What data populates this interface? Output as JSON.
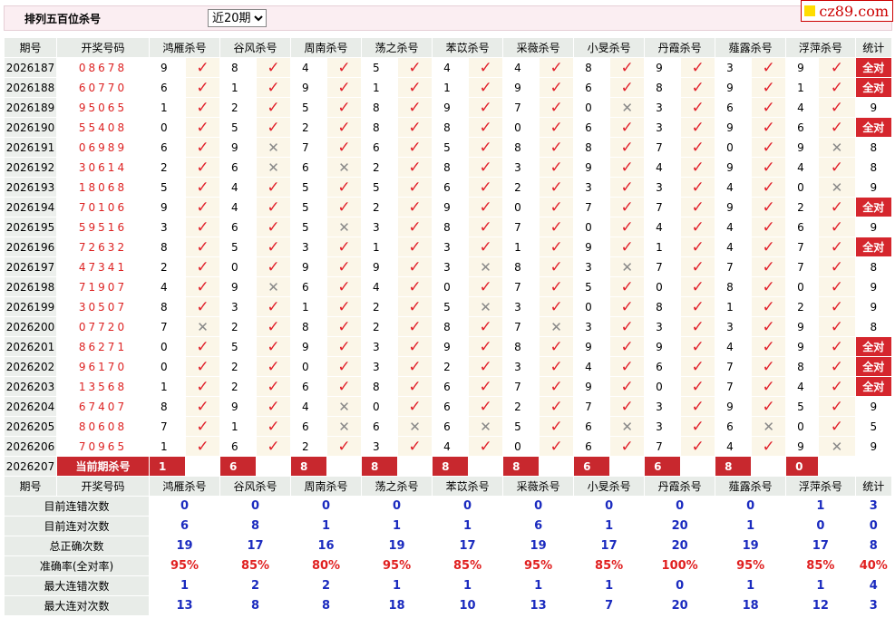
{
  "header": {
    "title": "排列五百位杀号",
    "period_select": "近20期",
    "logo": "cz89.com"
  },
  "columns": [
    "期号",
    "开奖号码",
    "鸿雁杀号",
    "谷风杀号",
    "周南杀号",
    "荡之杀号",
    "苯苡杀号",
    "采薇杀号",
    "小旻杀号",
    "丹霞杀号",
    "薤露杀号",
    "浮萍杀号",
    "统计"
  ],
  "rows": [
    {
      "period": "2026187",
      "code": "08678",
      "kills": [
        [
          9,
          1
        ],
        [
          8,
          1
        ],
        [
          4,
          1
        ],
        [
          5,
          1
        ],
        [
          4,
          1
        ],
        [
          4,
          1
        ],
        [
          8,
          1
        ],
        [
          9,
          1
        ],
        [
          3,
          1
        ],
        [
          9,
          1
        ]
      ],
      "stat": "全对"
    },
    {
      "period": "2026188",
      "code": "60770",
      "kills": [
        [
          6,
          1
        ],
        [
          1,
          1
        ],
        [
          9,
          1
        ],
        [
          1,
          1
        ],
        [
          1,
          1
        ],
        [
          9,
          1
        ],
        [
          6,
          1
        ],
        [
          8,
          1
        ],
        [
          9,
          1
        ],
        [
          1,
          1
        ]
      ],
      "stat": "全对"
    },
    {
      "period": "2026189",
      "code": "95065",
      "kills": [
        [
          1,
          1
        ],
        [
          2,
          1
        ],
        [
          5,
          1
        ],
        [
          8,
          1
        ],
        [
          9,
          1
        ],
        [
          7,
          1
        ],
        [
          0,
          0
        ],
        [
          3,
          1
        ],
        [
          6,
          1
        ],
        [
          4,
          1
        ]
      ],
      "stat": "9"
    },
    {
      "period": "2026190",
      "code": "55408",
      "kills": [
        [
          0,
          1
        ],
        [
          5,
          1
        ],
        [
          2,
          1
        ],
        [
          8,
          1
        ],
        [
          8,
          1
        ],
        [
          0,
          1
        ],
        [
          6,
          1
        ],
        [
          3,
          1
        ],
        [
          9,
          1
        ],
        [
          6,
          1
        ]
      ],
      "stat": "全对"
    },
    {
      "period": "2026191",
      "code": "06989",
      "kills": [
        [
          6,
          1
        ],
        [
          9,
          0
        ],
        [
          7,
          1
        ],
        [
          6,
          1
        ],
        [
          5,
          1
        ],
        [
          8,
          1
        ],
        [
          8,
          1
        ],
        [
          7,
          1
        ],
        [
          0,
          1
        ],
        [
          9,
          0
        ]
      ],
      "stat": "8"
    },
    {
      "period": "2026192",
      "code": "30614",
      "kills": [
        [
          2,
          1
        ],
        [
          6,
          0
        ],
        [
          6,
          0
        ],
        [
          2,
          1
        ],
        [
          8,
          1
        ],
        [
          3,
          1
        ],
        [
          9,
          1
        ],
        [
          4,
          1
        ],
        [
          9,
          1
        ],
        [
          4,
          1
        ]
      ],
      "stat": "8"
    },
    {
      "period": "2026193",
      "code": "18068",
      "kills": [
        [
          5,
          1
        ],
        [
          4,
          1
        ],
        [
          5,
          1
        ],
        [
          5,
          1
        ],
        [
          6,
          1
        ],
        [
          2,
          1
        ],
        [
          3,
          1
        ],
        [
          3,
          1
        ],
        [
          4,
          1
        ],
        [
          0,
          0
        ]
      ],
      "stat": "9"
    },
    {
      "period": "2026194",
      "code": "70106",
      "kills": [
        [
          9,
          1
        ],
        [
          4,
          1
        ],
        [
          5,
          1
        ],
        [
          2,
          1
        ],
        [
          9,
          1
        ],
        [
          0,
          1
        ],
        [
          7,
          1
        ],
        [
          7,
          1
        ],
        [
          9,
          1
        ],
        [
          2,
          1
        ]
      ],
      "stat": "全对"
    },
    {
      "period": "2026195",
      "code": "59516",
      "kills": [
        [
          3,
          1
        ],
        [
          6,
          1
        ],
        [
          5,
          0
        ],
        [
          3,
          1
        ],
        [
          8,
          1
        ],
        [
          7,
          1
        ],
        [
          0,
          1
        ],
        [
          4,
          1
        ],
        [
          4,
          1
        ],
        [
          6,
          1
        ]
      ],
      "stat": "9"
    },
    {
      "period": "2026196",
      "code": "72632",
      "kills": [
        [
          8,
          1
        ],
        [
          5,
          1
        ],
        [
          3,
          1
        ],
        [
          1,
          1
        ],
        [
          3,
          1
        ],
        [
          1,
          1
        ],
        [
          9,
          1
        ],
        [
          1,
          1
        ],
        [
          4,
          1
        ],
        [
          7,
          1
        ]
      ],
      "stat": "全对"
    },
    {
      "period": "2026197",
      "code": "47341",
      "kills": [
        [
          2,
          1
        ],
        [
          0,
          1
        ],
        [
          9,
          1
        ],
        [
          9,
          1
        ],
        [
          3,
          0
        ],
        [
          8,
          1
        ],
        [
          3,
          0
        ],
        [
          7,
          1
        ],
        [
          7,
          1
        ],
        [
          7,
          1
        ]
      ],
      "stat": "8"
    },
    {
      "period": "2026198",
      "code": "71907",
      "kills": [
        [
          4,
          1
        ],
        [
          9,
          0
        ],
        [
          6,
          1
        ],
        [
          4,
          1
        ],
        [
          0,
          1
        ],
        [
          7,
          1
        ],
        [
          5,
          1
        ],
        [
          0,
          1
        ],
        [
          8,
          1
        ],
        [
          0,
          1
        ]
      ],
      "stat": "9"
    },
    {
      "period": "2026199",
      "code": "30507",
      "kills": [
        [
          8,
          1
        ],
        [
          3,
          1
        ],
        [
          1,
          1
        ],
        [
          2,
          1
        ],
        [
          5,
          0
        ],
        [
          3,
          1
        ],
        [
          0,
          1
        ],
        [
          8,
          1
        ],
        [
          1,
          1
        ],
        [
          2,
          1
        ]
      ],
      "stat": "9"
    },
    {
      "period": "2026200",
      "code": "07720",
      "kills": [
        [
          7,
          0
        ],
        [
          2,
          1
        ],
        [
          8,
          1
        ],
        [
          2,
          1
        ],
        [
          8,
          1
        ],
        [
          7,
          0
        ],
        [
          3,
          1
        ],
        [
          3,
          1
        ],
        [
          3,
          1
        ],
        [
          9,
          1
        ]
      ],
      "stat": "8"
    },
    {
      "period": "2026201",
      "code": "86271",
      "kills": [
        [
          0,
          1
        ],
        [
          5,
          1
        ],
        [
          9,
          1
        ],
        [
          3,
          1
        ],
        [
          9,
          1
        ],
        [
          8,
          1
        ],
        [
          9,
          1
        ],
        [
          9,
          1
        ],
        [
          4,
          1
        ],
        [
          9,
          1
        ]
      ],
      "stat": "全对"
    },
    {
      "period": "2026202",
      "code": "96170",
      "kills": [
        [
          0,
          1
        ],
        [
          2,
          1
        ],
        [
          0,
          1
        ],
        [
          3,
          1
        ],
        [
          2,
          1
        ],
        [
          3,
          1
        ],
        [
          4,
          1
        ],
        [
          6,
          1
        ],
        [
          7,
          1
        ],
        [
          8,
          1
        ]
      ],
      "stat": "全对"
    },
    {
      "period": "2026203",
      "code": "13568",
      "kills": [
        [
          1,
          1
        ],
        [
          2,
          1
        ],
        [
          6,
          1
        ],
        [
          8,
          1
        ],
        [
          6,
          1
        ],
        [
          7,
          1
        ],
        [
          9,
          1
        ],
        [
          0,
          1
        ],
        [
          7,
          1
        ],
        [
          4,
          1
        ]
      ],
      "stat": "全对"
    },
    {
      "period": "2026204",
      "code": "67407",
      "kills": [
        [
          8,
          1
        ],
        [
          9,
          1
        ],
        [
          4,
          0
        ],
        [
          0,
          1
        ],
        [
          6,
          1
        ],
        [
          2,
          1
        ],
        [
          7,
          1
        ],
        [
          3,
          1
        ],
        [
          9,
          1
        ],
        [
          5,
          1
        ]
      ],
      "stat": "9"
    },
    {
      "period": "2026205",
      "code": "80608",
      "kills": [
        [
          7,
          1
        ],
        [
          1,
          1
        ],
        [
          6,
          0
        ],
        [
          6,
          0
        ],
        [
          6,
          0
        ],
        [
          5,
          1
        ],
        [
          6,
          0
        ],
        [
          3,
          1
        ],
        [
          6,
          0
        ],
        [
          0,
          1
        ]
      ],
      "stat": "5"
    },
    {
      "period": "2026206",
      "code": "70965",
      "kills": [
        [
          1,
          1
        ],
        [
          6,
          1
        ],
        [
          2,
          1
        ],
        [
          3,
          1
        ],
        [
          4,
          1
        ],
        [
          0,
          1
        ],
        [
          6,
          1
        ],
        [
          7,
          1
        ],
        [
          4,
          1
        ],
        [
          9,
          0
        ]
      ],
      "stat": "9"
    }
  ],
  "current": {
    "period": "2026207",
    "label": "当前期杀号",
    "kills": [
      "1",
      "6",
      "8",
      "8",
      "8",
      "8",
      "6",
      "6",
      "8",
      "0"
    ]
  },
  "footer_header": [
    "期号",
    "开奖号码",
    "鸿雁杀号",
    "谷风杀号",
    "周南杀号",
    "荡之杀号",
    "苯苡杀号",
    "采薇杀号",
    "小旻杀号",
    "丹霞杀号",
    "薤露杀号",
    "浮萍杀号",
    "统计"
  ],
  "footer": [
    {
      "label": "目前连错次数",
      "values": [
        "0",
        "0",
        "0",
        "0",
        "0",
        "0",
        "0",
        "0",
        "0",
        "1",
        "3"
      ],
      "red": false
    },
    {
      "label": "目前连对次数",
      "values": [
        "6",
        "8",
        "1",
        "1",
        "1",
        "6",
        "1",
        "20",
        "1",
        "0",
        "0"
      ],
      "red": false
    },
    {
      "label": "总正确次数",
      "values": [
        "19",
        "17",
        "16",
        "19",
        "17",
        "19",
        "17",
        "20",
        "19",
        "17",
        "8"
      ],
      "red": false
    },
    {
      "label": "准确率(全对率)",
      "values": [
        "95%",
        "85%",
        "80%",
        "95%",
        "85%",
        "95%",
        "85%",
        "100%",
        "95%",
        "85%",
        "40%"
      ],
      "red": true
    },
    {
      "label": "最大连错次数",
      "values": [
        "1",
        "2",
        "2",
        "1",
        "1",
        "1",
        "1",
        "0",
        "1",
        "1",
        "4"
      ],
      "red": false
    },
    {
      "label": "最大连对次数",
      "values": [
        "13",
        "8",
        "8",
        "18",
        "10",
        "13",
        "7",
        "20",
        "18",
        "12",
        "3"
      ],
      "red": false
    }
  ],
  "symbols": {
    "tick": "✓",
    "cross": "✕"
  },
  "colors": {
    "accent_red": "#c8282e",
    "code_red": "#d22",
    "stat_blue": "#1b2bbf"
  }
}
